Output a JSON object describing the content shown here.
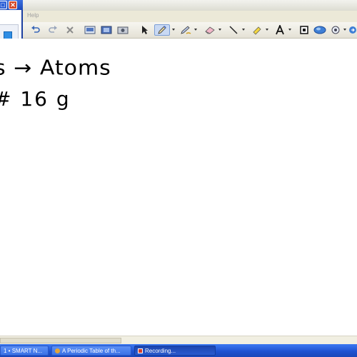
{
  "menubar": {
    "help_label": "Help"
  },
  "toolbar": {
    "icons": [
      "undo-icon",
      "redo-icon",
      "delete-icon",
      "screen-icon",
      "fullscreen-icon",
      "capture-icon",
      "select-icon",
      "pen-icon",
      "creative-pen-icon",
      "eraser-icon",
      "line-icon",
      "highlighter-icon",
      "text-icon",
      "shape-icon",
      "fill-icon",
      "camera-icon"
    ],
    "selected_tool": "pen-icon"
  },
  "whiteboard": {
    "line1": "s → Atoms",
    "line2": "# 16 g"
  },
  "taskbar": {
    "items": [
      {
        "label": "1 • SMART N..."
      },
      {
        "label": "A Periodic Table of th..."
      },
      {
        "label": "Recording..."
      }
    ]
  },
  "colors": {
    "taskbar": "#245edb",
    "widget_border": "#1c3fa0",
    "close": "#d44a2b"
  }
}
